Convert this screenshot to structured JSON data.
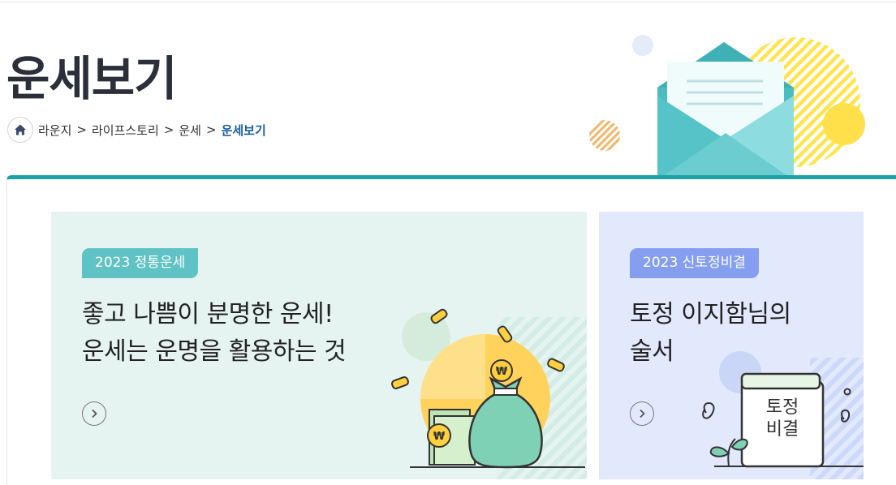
{
  "page": {
    "title": "운세보기",
    "breadcrumb": [
      "라운지",
      "라이프스토리",
      "운세",
      "운세보기"
    ],
    "breadcrumb_separator": ">"
  },
  "cards": [
    {
      "badge": "2023 정통운세",
      "headline": [
        "좋고 나쁨이 분명한 운세!",
        "운세는 운명을 활용하는 것"
      ],
      "icon": "money-bag-with-coins"
    },
    {
      "badge": "2023 신토정비결",
      "headline": [
        "토정 이지함님의",
        "술서"
      ],
      "book_text": [
        "토정",
        "비결"
      ],
      "icon": "tojeong-book"
    }
  ],
  "colors": {
    "accent": "#1fa0a6",
    "card1_bg": "#e6f4f1",
    "card2_bg": "#e2e9fd",
    "badge1": "#5fc2c4",
    "badge2": "#869ef0",
    "current_crumb": "#1b5f9e"
  }
}
